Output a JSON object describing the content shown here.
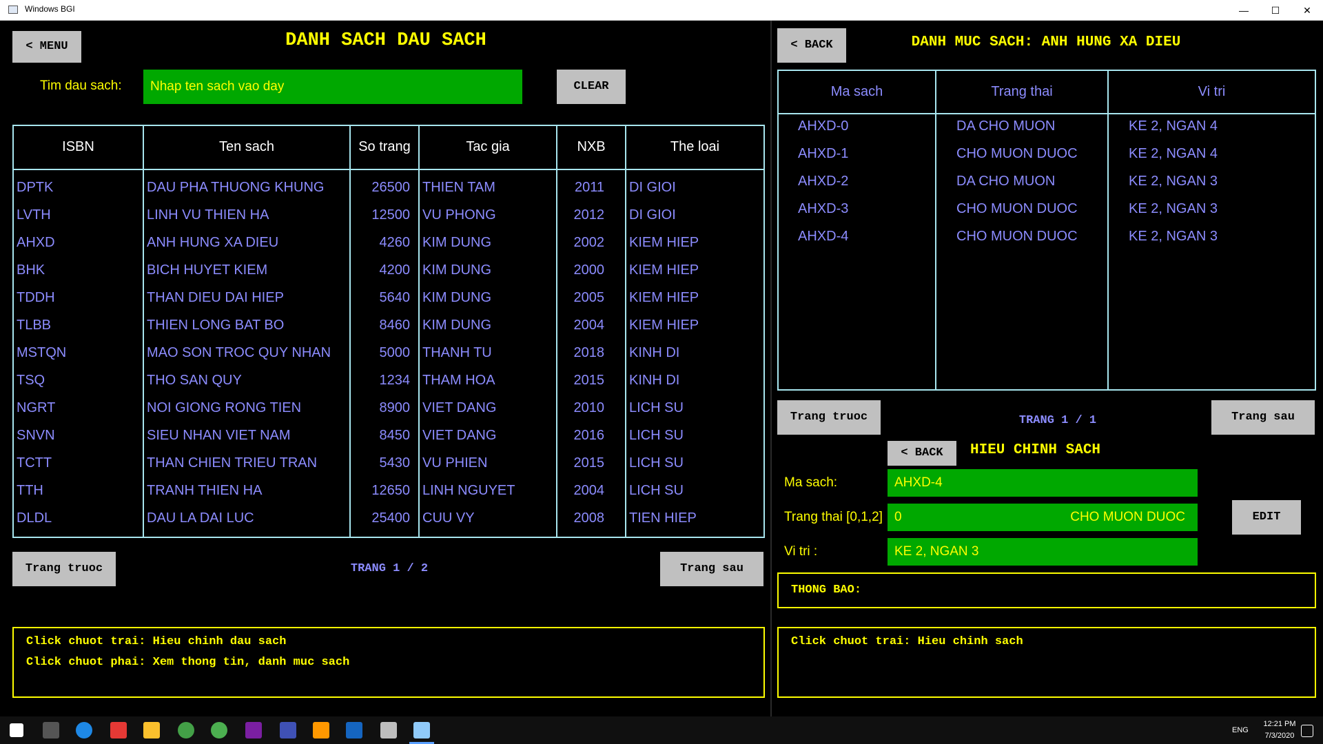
{
  "window": {
    "title": "Windows BGI",
    "minimize": "—",
    "maximize": "☐",
    "close": "✕"
  },
  "left": {
    "menu_button": "< MENU",
    "title": "DANH SACH DAU SACH",
    "search_label": "Tim dau sach:",
    "search_placeholder": "Nhap ten sach vao day",
    "clear_button": "CLEAR",
    "columns": [
      "ISBN",
      "Ten sach",
      "So trang",
      "Tac gia",
      "NXB",
      "The loai"
    ],
    "rows": [
      [
        "DPTK",
        "DAU PHA THUONG KHUNG",
        "26500",
        "THIEN TAM",
        "2011",
        "DI GIOI"
      ],
      [
        "LVTH",
        "LINH VU THIEN HA",
        "12500",
        "VU PHONG",
        "2012",
        "DI GIOI"
      ],
      [
        "AHXD",
        "ANH HUNG XA DIEU",
        "4260",
        "KIM DUNG",
        "2002",
        "KIEM HIEP"
      ],
      [
        "BHK",
        "BICH HUYET KIEM",
        "4200",
        "KIM DUNG",
        "2000",
        "KIEM HIEP"
      ],
      [
        "TDDH",
        "THAN DIEU DAI HIEP",
        "5640",
        "KIM DUNG",
        "2005",
        "KIEM HIEP"
      ],
      [
        "TLBB",
        "THIEN LONG BAT BO",
        "8460",
        "KIM DUNG",
        "2004",
        "KIEM HIEP"
      ],
      [
        "MSTQN",
        "MAO SON TROC QUY NHAN",
        "5000",
        "THANH TU",
        "2018",
        "KINH DI"
      ],
      [
        "TSQ",
        "THO SAN QUY",
        "1234",
        "THAM HOA",
        "2015",
        "KINH DI"
      ],
      [
        "NGRT",
        "NOI GIONG RONG TIEN",
        "8900",
        "VIET DANG",
        "2010",
        "LICH SU"
      ],
      [
        "SNVN",
        "SIEU NHAN VIET NAM",
        "8450",
        "VIET DANG",
        "2016",
        "LICH SU"
      ],
      [
        "TCTT",
        "THAN CHIEN TRIEU TRAN",
        "5430",
        "VU PHIEN",
        "2015",
        "LICH SU"
      ],
      [
        "TTH",
        "TRANH THIEN HA",
        "12650",
        "LINH NGUYET",
        "2004",
        "LICH SU"
      ],
      [
        "DLDL",
        "DAU LA DAI LUC",
        "25400",
        "CUU VY",
        "2008",
        "TIEN HIEP"
      ]
    ],
    "prev_button": "Trang truoc",
    "next_button": "Trang sau",
    "page_label": "TRANG 1 / 2",
    "hint_line1": "Click chuot trai: Hieu chinh dau sach",
    "hint_line2": "Click chuot phai: Xem thong tin, danh muc sach"
  },
  "right": {
    "back_button": "< BACK",
    "title": "DANH MUC SACH: ANH HUNG XA DIEU",
    "columns": [
      "Ma sach",
      "Trang thai",
      "Vi tri"
    ],
    "rows": [
      [
        "AHXD-0",
        "DA CHO MUON",
        "KE 2, NGAN 4"
      ],
      [
        "AHXD-1",
        "CHO MUON DUOC",
        "KE 2, NGAN 4"
      ],
      [
        "AHXD-2",
        "DA CHO MUON",
        "KE 2, NGAN 3"
      ],
      [
        "AHXD-3",
        "CHO MUON DUOC",
        "KE 2, NGAN 3"
      ],
      [
        "AHXD-4",
        "CHO MUON DUOC",
        "KE 2, NGAN 3"
      ]
    ],
    "prev_button": "Trang truoc",
    "next_button": "Trang sau",
    "page_label": "TRANG 1 / 1",
    "edit": {
      "back_button": "< BACK",
      "title": "HIEU CHINH SACH",
      "ma_sach_label": "Ma sach:",
      "ma_sach_value": "AHXD-4",
      "trang_thai_label": "Trang thai [0,1,2]",
      "trang_thai_value": "0",
      "trang_thai_text": "CHO MUON DUOC",
      "vi_tri_label": "Vi tri :",
      "vi_tri_value": "KE 2, NGAN 3",
      "edit_button": "EDIT"
    },
    "notice_label": "THONG BAO:",
    "hint_line1": "Click chuot trai: Hieu chinh sach"
  },
  "taskbar": {
    "lang": "ENG",
    "time": "12:21 PM",
    "date": "7/3/2020"
  },
  "colors": {
    "accent_yellow": "#ffff00",
    "cell_text": "#8c8cff",
    "border_cyan": "#a8e6ef",
    "field_green": "#00a800"
  }
}
